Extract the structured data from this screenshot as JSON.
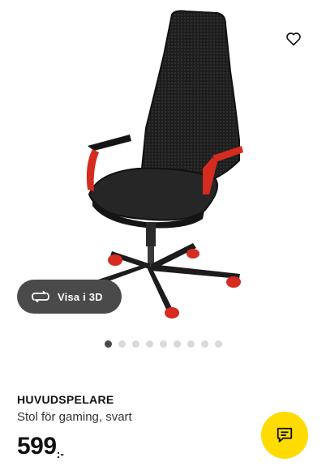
{
  "product": {
    "name": "HUVUDSPELARE",
    "description": "Stol för gaming, svart",
    "price_integer": "599",
    "price_suffix": ":-"
  },
  "media": {
    "image_alt": "HUVUDSPELARE gaming chair",
    "view_3d_label": "Visa i 3D",
    "dots_total": 9,
    "active_dot": 0
  },
  "icons": {
    "favorite": "heart-icon",
    "view_3d": "rotate-3d-icon",
    "chat": "chat-bubble-icon"
  },
  "colors": {
    "chair_body": "#222222",
    "chair_accent": "#d62b1f",
    "chat_button": "#ffdb00",
    "view_3d_button": "#4a4a4a"
  }
}
